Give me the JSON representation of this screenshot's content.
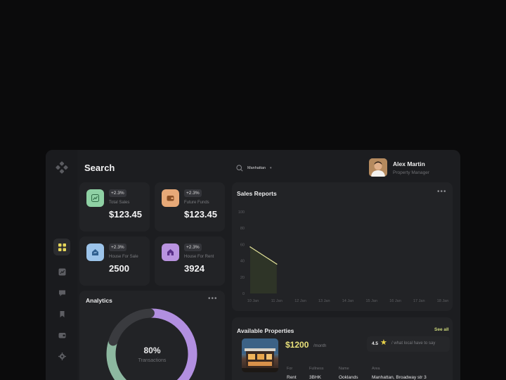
{
  "page": {
    "title": "Search"
  },
  "sidebar": {
    "items": [
      {
        "icon": "grid-icon",
        "active": true
      },
      {
        "icon": "chart-box-icon",
        "active": false
      },
      {
        "icon": "message-icon",
        "active": false
      },
      {
        "icon": "bookmark-icon",
        "active": false
      },
      {
        "icon": "wallet-icon",
        "active": false
      },
      {
        "icon": "gear-icon",
        "active": false
      }
    ]
  },
  "search": {
    "value": "Manhattan"
  },
  "profile": {
    "name": "Alex Martin",
    "role": "Property Manager"
  },
  "stats": [
    {
      "badge": "+2.3%",
      "label": "Total Sales",
      "value": "$123.45",
      "icon": "chart-icon",
      "color": "#8fd1a4"
    },
    {
      "badge": "+2.3%",
      "label": "Future Funds",
      "value": "$123.45",
      "icon": "wallet-icon",
      "color": "#e7a978"
    },
    {
      "badge": "+2.3%",
      "label": "House For Sale",
      "value": "2500",
      "icon": "house-sale-icon",
      "color": "#9cc4ea"
    },
    {
      "badge": "+2.3%",
      "label": "House For Rent",
      "value": "3924",
      "icon": "house-rent-icon",
      "color": "#b993e0"
    }
  ],
  "analytics": {
    "title": "Analytics",
    "percent": "80%",
    "label": "Transactions",
    "segments": [
      {
        "value": 55,
        "color": "#b28fe0"
      },
      {
        "value": 25,
        "color": "#8db8a0"
      },
      {
        "value": 20,
        "color": "#3a3b3f"
      }
    ]
  },
  "sales_report": {
    "title": "Sales Reports"
  },
  "chart_data": {
    "type": "area",
    "title": "Sales Reports",
    "xlabel": "",
    "ylabel": "",
    "ylim": [
      0,
      100
    ],
    "y_ticks": [
      "100",
      "80",
      "60",
      "40",
      "20",
      "0"
    ],
    "categories": [
      "10 Jan",
      "11 Jan",
      "12 Jan",
      "13 Jan",
      "14 Jan",
      "15 Jan",
      "16 Jan",
      "17 Jan",
      "18 Jan"
    ],
    "series": [
      {
        "values": [
          57,
          36
        ],
        "color": "#e4e39a"
      }
    ],
    "grid": false
  },
  "properties": {
    "title": "Available Properties",
    "see_all": "See all",
    "item": {
      "price": "$1200",
      "unit": "/month",
      "rating": "4.5",
      "rating_text": "/ what local have to say",
      "details": [
        {
          "label": "For",
          "value": "Rent"
        },
        {
          "label": "Fullness",
          "value": "3BHK"
        },
        {
          "label": "Name",
          "value": "Ooklands"
        },
        {
          "label": "Area",
          "value": "Manhattan, Broadway str 3"
        }
      ]
    }
  }
}
